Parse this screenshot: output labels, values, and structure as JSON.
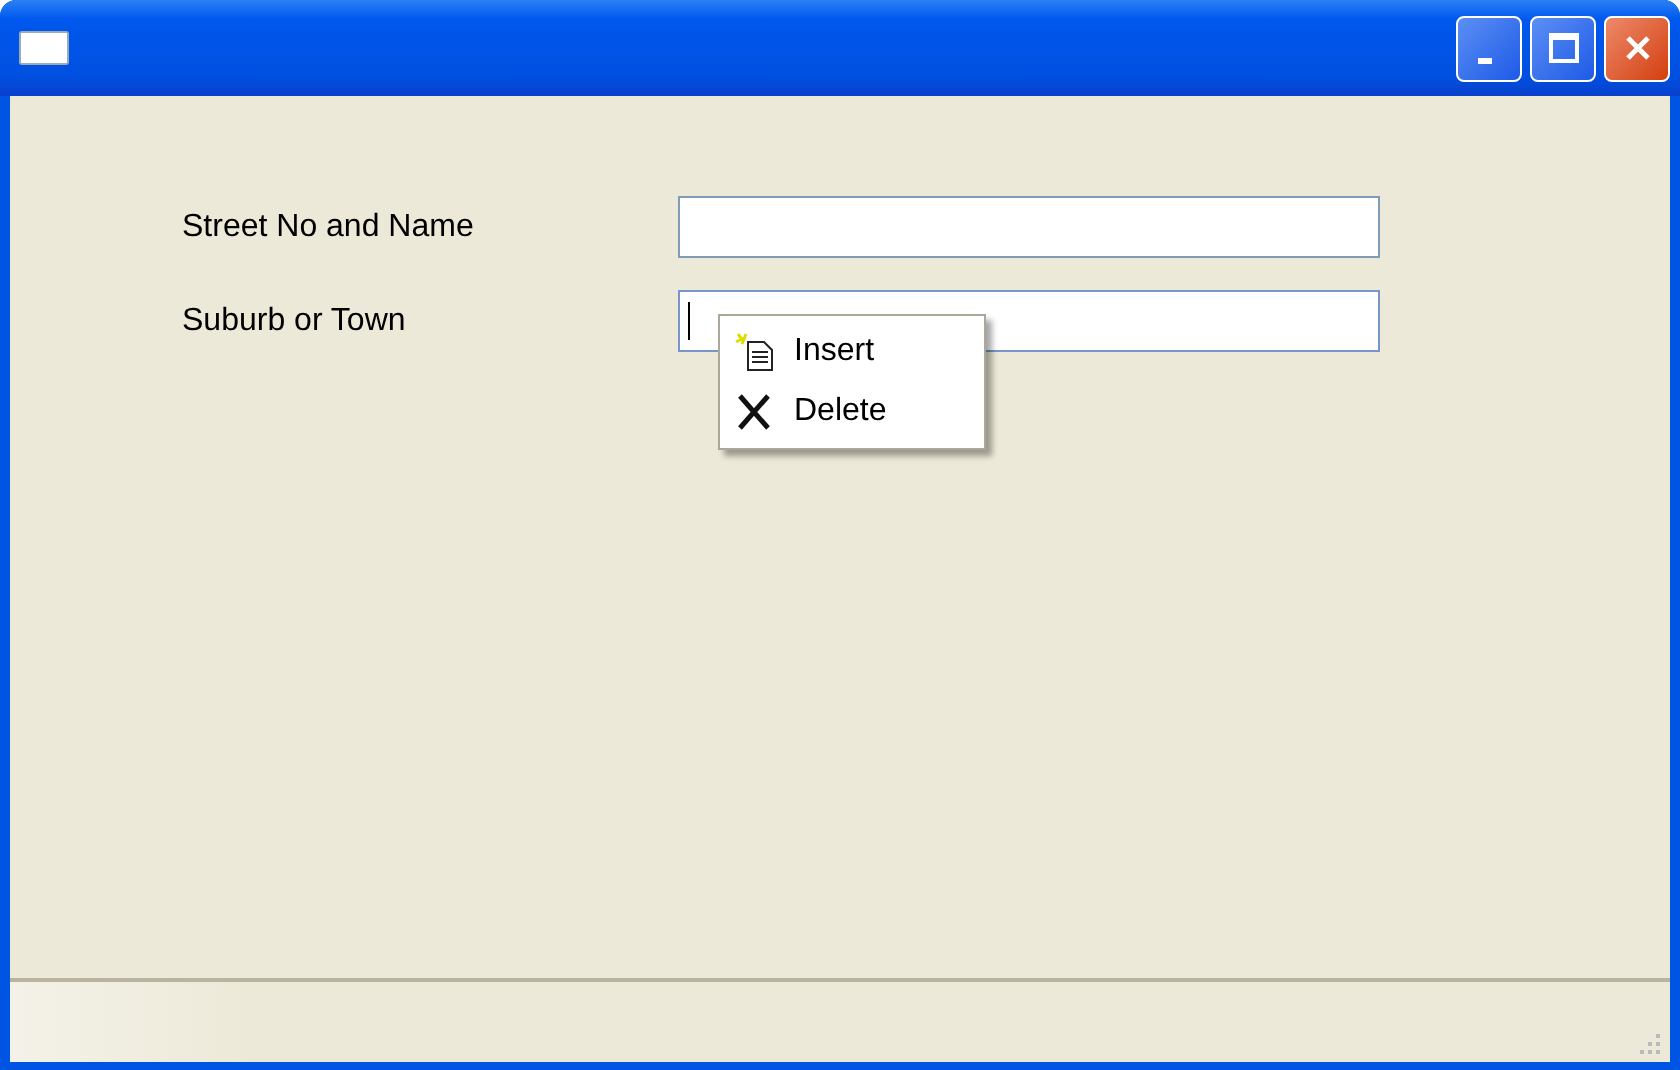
{
  "fields": [
    {
      "label": "Street No and Name",
      "focused": false
    },
    {
      "label": "Suburb or Town",
      "focused": true
    }
  ],
  "context_menu": {
    "items": [
      {
        "label": "Insert",
        "kind": "insert"
      },
      {
        "label": "Delete",
        "kind": "delete"
      }
    ]
  }
}
